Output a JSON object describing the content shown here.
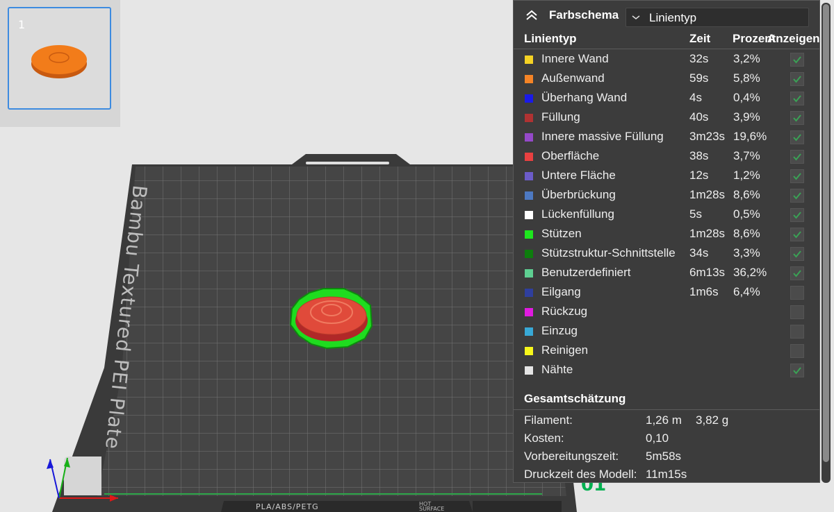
{
  "thumbnail": {
    "number": "1"
  },
  "plate": {
    "label": "Bambu Textured PEI Plate",
    "material_label": "PLA/ABS/PETG",
    "warning_label": "HOT SURFACE",
    "corner_number": "01"
  },
  "legend": {
    "title": "Farbschema",
    "view_type": "Linientyp",
    "columns": {
      "type": "Linientyp",
      "time": "Zeit",
      "percent": "Prozent",
      "show": "Anzeigen"
    },
    "rows": [
      {
        "name": "Innere Wand",
        "time": "32s",
        "percent": "3,2%",
        "color": "#f5d224",
        "shown": true
      },
      {
        "name": "Außenwand",
        "time": "59s",
        "percent": "5,8%",
        "color": "#f58426",
        "shown": true
      },
      {
        "name": "Überhang Wand",
        "time": "4s",
        "percent": "0,4%",
        "color": "#1a1ae8",
        "shown": true
      },
      {
        "name": "Füllung",
        "time": "40s",
        "percent": "3,9%",
        "color": "#b03232",
        "shown": true
      },
      {
        "name": "Innere massive Füllung",
        "time": "3m23s",
        "percent": "19,6%",
        "color": "#9549c9",
        "shown": true
      },
      {
        "name": "Oberfläche",
        "time": "38s",
        "percent": "3,7%",
        "color": "#e84040",
        "shown": true
      },
      {
        "name": "Untere Fläche",
        "time": "12s",
        "percent": "1,2%",
        "color": "#6c5cc9",
        "shown": true
      },
      {
        "name": "Überbrückung",
        "time": "1m28s",
        "percent": "8,6%",
        "color": "#4d79c2",
        "shown": true
      },
      {
        "name": "Lückenfüllung",
        "time": "5s",
        "percent": "0,5%",
        "color": "#ffffff",
        "shown": true
      },
      {
        "name": "Stützen",
        "time": "1m28s",
        "percent": "8,6%",
        "color": "#1ee61e",
        "shown": true
      },
      {
        "name": "Stützstruktur-Schnittstelle",
        "time": "34s",
        "percent": "3,3%",
        "color": "#0d7d0d",
        "shown": true
      },
      {
        "name": "Benutzerdefiniert",
        "time": "6m13s",
        "percent": "36,2%",
        "color": "#5ecf92",
        "shown": true
      },
      {
        "name": "Eilgang",
        "time": "1m6s",
        "percent": "6,4%",
        "color": "#2f3f9e",
        "shown": false
      },
      {
        "name": "Rückzug",
        "time": "",
        "percent": "",
        "color": "#e01be0",
        "shown": false
      },
      {
        "name": "Einzug",
        "time": "",
        "percent": "",
        "color": "#38a9d6",
        "shown": false
      },
      {
        "name": "Reinigen",
        "time": "",
        "percent": "",
        "color": "#f7f71b",
        "shown": false
      },
      {
        "name": "Nähte",
        "time": "",
        "percent": "",
        "color": "#e5e5e5",
        "shown": true
      }
    ]
  },
  "summary": {
    "title": "Gesamtschätzung",
    "rows": [
      {
        "label": "Filament:",
        "value1": "1,26 m",
        "value2": "3,82 g"
      },
      {
        "label": "Kosten:",
        "value1": "0,10",
        "value2": ""
      },
      {
        "label": "Vorbereitungszeit:",
        "value1": "5m58s",
        "value2": ""
      },
      {
        "label": "Druckzeit des Modell:",
        "value1": "11m15s",
        "value2": ""
      }
    ]
  },
  "colors": {
    "accent_check": "#3aa255",
    "panel_bg": "#3c3c3c",
    "selection_blue": "#3d8be0",
    "origin_green": "#00b050"
  }
}
